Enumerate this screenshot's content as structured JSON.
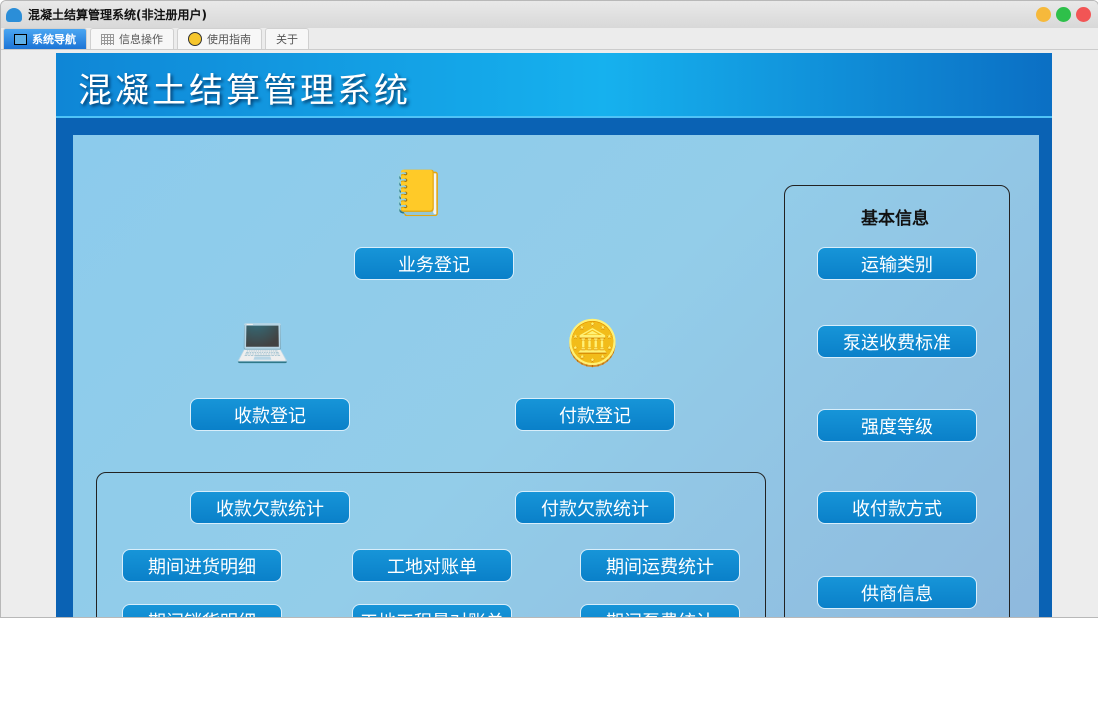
{
  "window": {
    "title": "混凝土结算管理系统(非注册用户)"
  },
  "tabs": [
    {
      "label": "系统导航"
    },
    {
      "label": "信息操作"
    },
    {
      "label": "使用指南"
    },
    {
      "label": "关于"
    }
  ],
  "banner": {
    "title": "混凝土结算管理系统"
  },
  "main": {
    "business": "业务登记",
    "receipt": "收款登记",
    "payment": "付款登记"
  },
  "stats": [
    "收款欠款统计",
    "付款欠款统计",
    "期间进货明细",
    "工地对账单",
    "期间运费统计",
    "期间销货明细",
    "工地工程量对账单",
    "期间泵费统计"
  ],
  "basic": {
    "title": "基本信息",
    "items": [
      "运输类别",
      "泵送收费标准",
      "强度等级",
      "收付款方式",
      "供商信息"
    ]
  },
  "colors": {
    "accent": "#0a80c9",
    "tab_active": "#1c74d6"
  }
}
